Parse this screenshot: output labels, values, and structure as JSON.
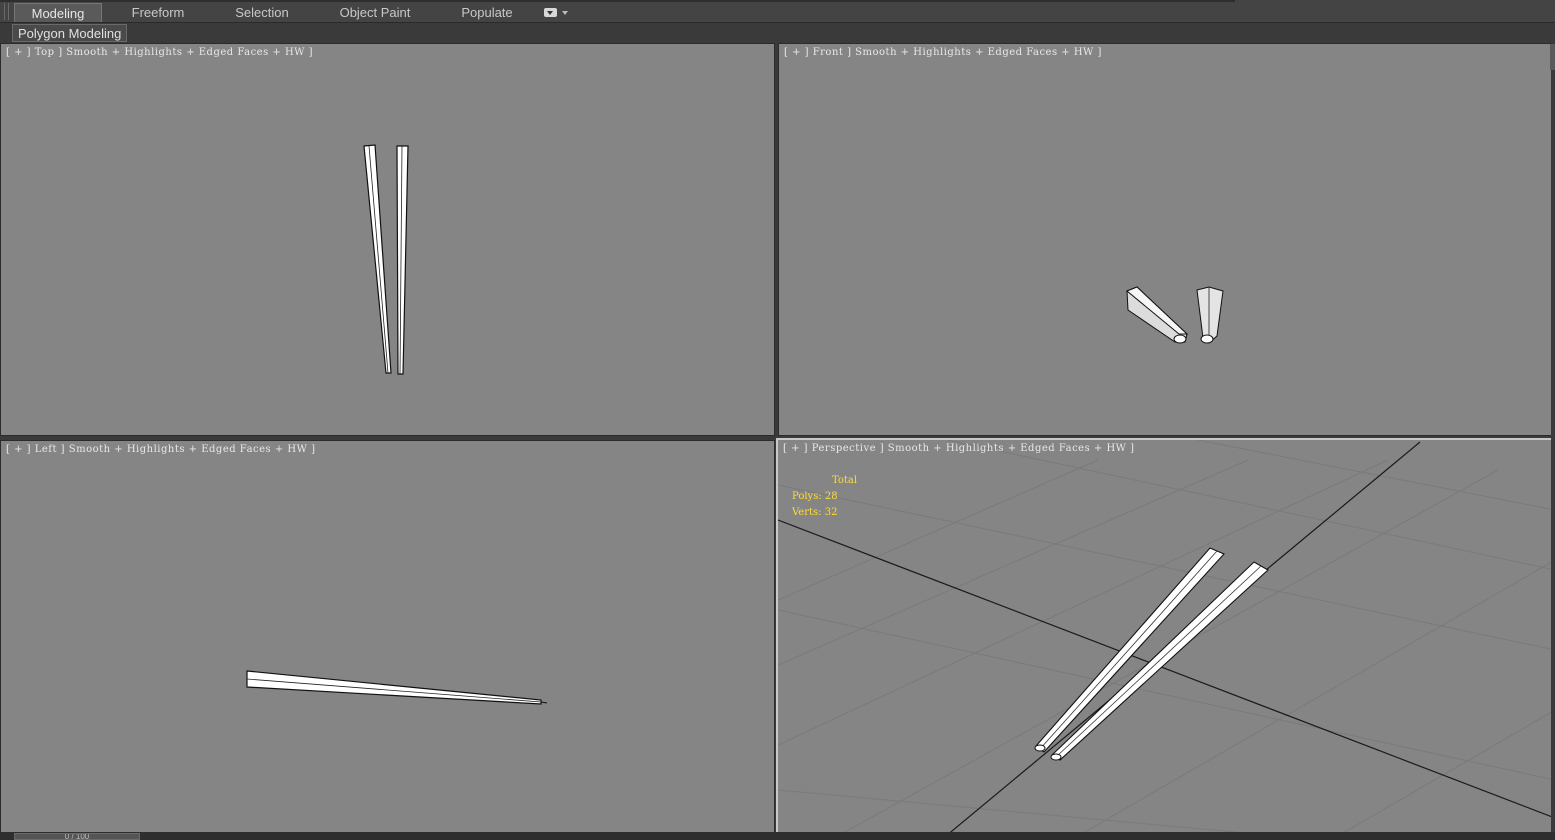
{
  "ribbon": {
    "tabs": [
      {
        "label": "Modeling"
      },
      {
        "label": "Freeform"
      },
      {
        "label": "Selection"
      },
      {
        "label": "Object Paint"
      },
      {
        "label": "Populate"
      }
    ],
    "active_tab": "Modeling"
  },
  "subbar": {
    "panel_label": "Polygon Modeling"
  },
  "viewports": {
    "top": {
      "label": "[ + ] Top ] Smooth + Highlights + Edged Faces + HW ]"
    },
    "front": {
      "label": "[ + ] Front ] Smooth + Highlights + Edged Faces + HW ]"
    },
    "left": {
      "label": "[ + ] Left ] Smooth + Highlights + Edged Faces + HW ]"
    },
    "perspective": {
      "label": "[ + ] Perspective ] Smooth + Highlights + Edged Faces + HW ]",
      "stats": {
        "header": "Total",
        "polys_label": "Polys:",
        "polys": "28",
        "verts_label": "Verts:",
        "verts": "32"
      }
    }
  },
  "colors": {
    "viewport_bg": "#858585",
    "stats_text": "#ffdc32",
    "ui_bg": "#3a3a3a"
  },
  "timeline": {
    "frame_text": "0 / 100"
  }
}
